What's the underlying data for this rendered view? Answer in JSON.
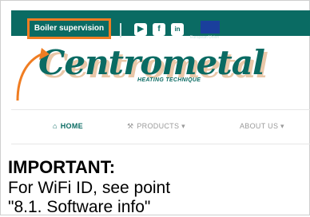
{
  "topbar": {
    "boiler_button": "Boiler supervision",
    "social": {
      "youtube": "▶",
      "facebook": "f",
      "linkedin": "in"
    },
    "flag_caption": "European Union"
  },
  "logo": {
    "brand": "Centrometal",
    "tagline": "HEATING TECHNIQUE"
  },
  "nav": {
    "items": [
      {
        "label": "HOME",
        "icon": "home-icon"
      },
      {
        "label": "PRODUCTS",
        "icon": "products-icon"
      },
      {
        "label": "ABOUT US",
        "icon": ""
      }
    ]
  },
  "notice": {
    "title": "IMPORTANT:",
    "line1": "For WiFi ID, see point",
    "line2": "\"8.1. Software info\""
  },
  "colors": {
    "brand": "#0a6b63",
    "highlight": "#f07d22"
  }
}
